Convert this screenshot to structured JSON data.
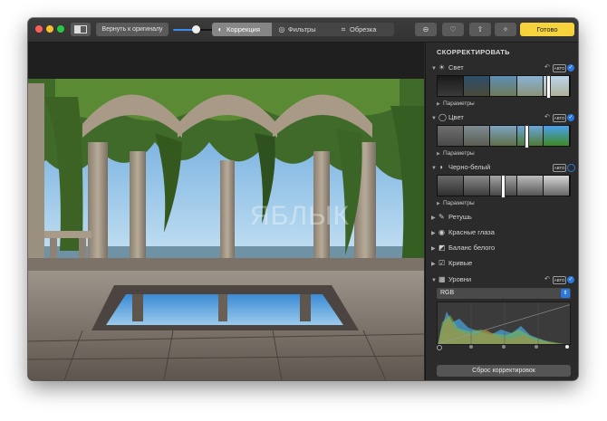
{
  "toolbar": {
    "revert_label": "Вернуть к оригиналу",
    "tabs": [
      {
        "label": "Коррекция",
        "icon": "adjust-icon",
        "active": true
      },
      {
        "label": "Фильтры",
        "icon": "filters-icon",
        "active": false
      },
      {
        "label": "Обрезка",
        "icon": "crop-icon",
        "active": false
      }
    ],
    "done_label": "Готово",
    "slider_level": 0.55
  },
  "photo": {
    "watermark": "ЯБЛЫК"
  },
  "panel": {
    "header": "СКОРРЕКТИРОВАТЬ",
    "sections": {
      "light": "Свет",
      "color": "Цвет",
      "bw": "Черно-белый",
      "retouch": "Ретушь",
      "redeye": "Красные глаза",
      "whitebalance": "Баланс белого",
      "curves": "Кривые",
      "levels": "Уровни"
    },
    "params_label": "Параметры",
    "auto_label": "АВТО",
    "levels_channel": "RGB",
    "reset_label": "Сброс корректировок"
  },
  "colors": {
    "accent": "#2a78e4",
    "done": "#f6d33c",
    "window_bg": "#2a2a2a"
  }
}
